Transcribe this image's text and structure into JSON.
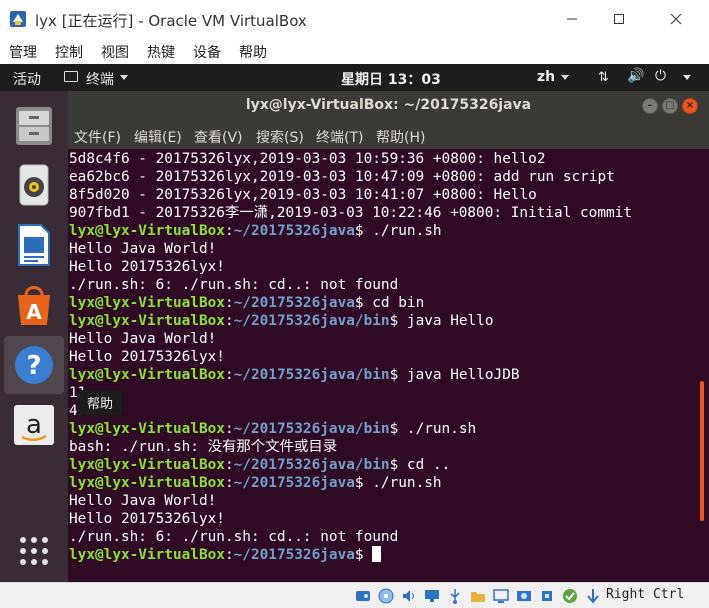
{
  "vbox": {
    "title": "lyx [正在运行] - Oracle VM VirtualBox",
    "menu": [
      "管理",
      "控制",
      "视图",
      "热键",
      "设备",
      "帮助"
    ],
    "status_host_key": "Right Ctrl"
  },
  "topbar": {
    "activities": "活动",
    "app_name": "终端",
    "clock": "星期日 13：03",
    "input_method": "zh"
  },
  "dock": {
    "items": [
      "file-manager",
      "rhythmbox",
      "libreoffice-writer",
      "ubuntu-software",
      "help",
      "amazon",
      "show-applications"
    ],
    "tooltip": "帮助"
  },
  "terminal": {
    "title": "lyx@lyx-VirtualBox: ~/20175326java",
    "menu": [
      "文件(F)",
      "编辑(E)",
      "查看(V)",
      "搜索(S)",
      "终端(T)",
      "帮助(H)"
    ],
    "lines": [
      {
        "text": "5d8c4f6 - 20175326lyx,2019-03-03 10:59:36 +0800: hello2"
      },
      {
        "text": "ea62bc6 - 20175326lyx,2019-03-03 10:47:09 +0800: add run script"
      },
      {
        "text": "8f5d020 - 20175326lyx,2019-03-03 10:41:07 +0800: Hello"
      },
      {
        "text": "907fbd1 - 20175326李一潇,2019-03-03 10:22:46 +0800: Initial commit"
      },
      {
        "user": "lyx@lyx-VirtualBox",
        "path": "~/20175326java",
        "cmd": "$ ./run.sh"
      },
      {
        "text": "Hello Java World!"
      },
      {
        "text": "Hello 20175326lyx!"
      },
      {
        "text": "./run.sh: 6: ./run.sh: cd..: not found"
      },
      {
        "user": "lyx@lyx-VirtualBox",
        "path": "~/20175326java",
        "cmd": "$ cd bin"
      },
      {
        "user": "lyx@lyx-VirtualBox",
        "path": "~/20175326java/bin",
        "cmd": "$ java Hello"
      },
      {
        "text": "Hello Java World!"
      },
      {
        "text": "Hello 20175326lyx!"
      },
      {
        "user": "lyx@lyx-VirtualBox",
        "path": "~/20175326java/bin",
        "cmd": "$ java HelloJDB"
      },
      {
        "text": "11"
      },
      {
        "text": "4950"
      },
      {
        "user": "lyx@lyx-VirtualBox",
        "path": "~/20175326java/bin",
        "cmd": "$ ./run.sh"
      },
      {
        "text": "bash: ./run.sh: 没有那个文件或目录"
      },
      {
        "user": "lyx@lyx-VirtualBox",
        "path": "~/20175326java/bin",
        "cmd": "$ cd .."
      },
      {
        "user": "lyx@lyx-VirtualBox",
        "path": "~/20175326java",
        "cmd": "$ ./run.sh"
      },
      {
        "text": "Hello Java World!"
      },
      {
        "text": "Hello 20175326lyx!"
      },
      {
        "text": "./run.sh: 6: ./run.sh: cd..: not found"
      },
      {
        "user": "lyx@lyx-VirtualBox",
        "path": "~/20175326java",
        "cmd": "$ ",
        "cursor": true
      }
    ]
  },
  "colors": {
    "terminal_bg": "#300a24",
    "prompt_user": "#8ae234",
    "prompt_path": "#729fcf",
    "accent": "#e9541f"
  }
}
